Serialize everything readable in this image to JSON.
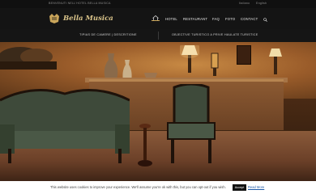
{
  "topbar": {
    "left_text": "BENVENUTI NELL'HOTEL BELLA MUSICA",
    "right_items": [
      "Italiano",
      "English"
    ]
  },
  "brand": {
    "name": "Bella Musica"
  },
  "nav": {
    "items": [
      "HOTEL",
      "RESTAURANT",
      "FAQ",
      "FOTO",
      "CONTACT"
    ]
  },
  "band": {
    "left": "TIPIAS DE CAMERE | DESCRITIONE",
    "right": "OBJECTIVE TURISTICO A PRIVE HAULATE TURISTICE"
  },
  "cookie": {
    "message": "This website uses cookies to improve your experience. We'll assume you're ok with this, but you can opt-out if you wish.",
    "accept_label": "Accept",
    "more_label": "Read More"
  },
  "colors": {
    "accent": "#c9a55a",
    "header_bg": "#141414",
    "cookie_bg": "#ffffff"
  }
}
